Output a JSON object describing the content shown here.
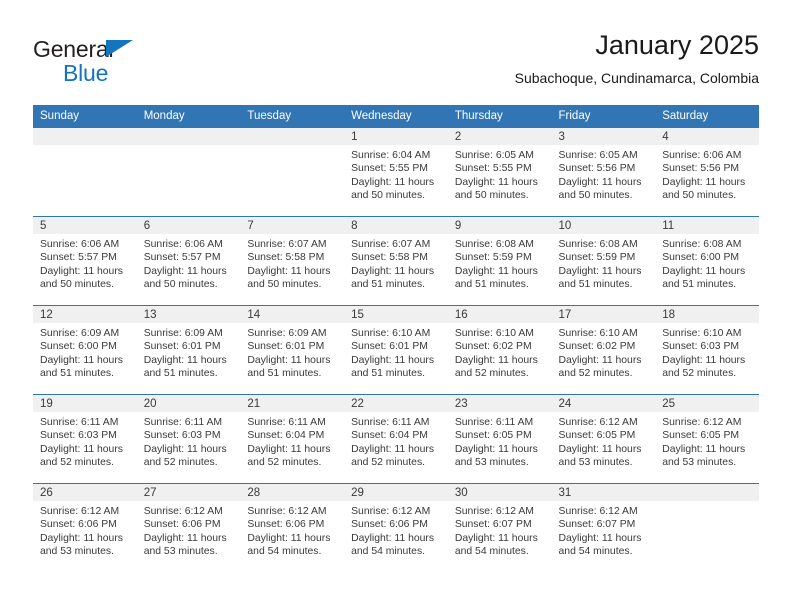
{
  "brand": {
    "name_part1": "General",
    "name_part2": "Blue",
    "triangle_icon": "brand-triangle-icon",
    "colors": {
      "dark": "#231f20",
      "blue": "#1574bf"
    }
  },
  "header": {
    "title": "January 2025",
    "subtitle": "Subachoque, Cundinamarca, Colombia"
  },
  "theme": {
    "header_blue": "#3175b5",
    "daynum_band": "#f0f0f0",
    "text": "#3a3a3a"
  },
  "calendar": {
    "weekday_headers": [
      "Sunday",
      "Monday",
      "Tuesday",
      "Wednesday",
      "Thursday",
      "Friday",
      "Saturday"
    ],
    "labels": {
      "sunrise": "Sunrise:",
      "sunset": "Sunset:",
      "daylight": "Daylight:"
    },
    "weeks": [
      [
        {
          "day": "",
          "empty": true
        },
        {
          "day": "",
          "empty": true
        },
        {
          "day": "",
          "empty": true
        },
        {
          "day": "1",
          "sunrise": "Sunrise: 6:04 AM",
          "sunset": "Sunset: 5:55 PM",
          "daylight_l1": "Daylight: 11 hours",
          "daylight_l2": "and 50 minutes."
        },
        {
          "day": "2",
          "sunrise": "Sunrise: 6:05 AM",
          "sunset": "Sunset: 5:55 PM",
          "daylight_l1": "Daylight: 11 hours",
          "daylight_l2": "and 50 minutes."
        },
        {
          "day": "3",
          "sunrise": "Sunrise: 6:05 AM",
          "sunset": "Sunset: 5:56 PM",
          "daylight_l1": "Daylight: 11 hours",
          "daylight_l2": "and 50 minutes."
        },
        {
          "day": "4",
          "sunrise": "Sunrise: 6:06 AM",
          "sunset": "Sunset: 5:56 PM",
          "daylight_l1": "Daylight: 11 hours",
          "daylight_l2": "and 50 minutes."
        }
      ],
      [
        {
          "day": "5",
          "sunrise": "Sunrise: 6:06 AM",
          "sunset": "Sunset: 5:57 PM",
          "daylight_l1": "Daylight: 11 hours",
          "daylight_l2": "and 50 minutes."
        },
        {
          "day": "6",
          "sunrise": "Sunrise: 6:06 AM",
          "sunset": "Sunset: 5:57 PM",
          "daylight_l1": "Daylight: 11 hours",
          "daylight_l2": "and 50 minutes."
        },
        {
          "day": "7",
          "sunrise": "Sunrise: 6:07 AM",
          "sunset": "Sunset: 5:58 PM",
          "daylight_l1": "Daylight: 11 hours",
          "daylight_l2": "and 50 minutes."
        },
        {
          "day": "8",
          "sunrise": "Sunrise: 6:07 AM",
          "sunset": "Sunset: 5:58 PM",
          "daylight_l1": "Daylight: 11 hours",
          "daylight_l2": "and 51 minutes."
        },
        {
          "day": "9",
          "sunrise": "Sunrise: 6:08 AM",
          "sunset": "Sunset: 5:59 PM",
          "daylight_l1": "Daylight: 11 hours",
          "daylight_l2": "and 51 minutes."
        },
        {
          "day": "10",
          "sunrise": "Sunrise: 6:08 AM",
          "sunset": "Sunset: 5:59 PM",
          "daylight_l1": "Daylight: 11 hours",
          "daylight_l2": "and 51 minutes."
        },
        {
          "day": "11",
          "sunrise": "Sunrise: 6:08 AM",
          "sunset": "Sunset: 6:00 PM",
          "daylight_l1": "Daylight: 11 hours",
          "daylight_l2": "and 51 minutes."
        }
      ],
      [
        {
          "day": "12",
          "sunrise": "Sunrise: 6:09 AM",
          "sunset": "Sunset: 6:00 PM",
          "daylight_l1": "Daylight: 11 hours",
          "daylight_l2": "and 51 minutes."
        },
        {
          "day": "13",
          "sunrise": "Sunrise: 6:09 AM",
          "sunset": "Sunset: 6:01 PM",
          "daylight_l1": "Daylight: 11 hours",
          "daylight_l2": "and 51 minutes."
        },
        {
          "day": "14",
          "sunrise": "Sunrise: 6:09 AM",
          "sunset": "Sunset: 6:01 PM",
          "daylight_l1": "Daylight: 11 hours",
          "daylight_l2": "and 51 minutes."
        },
        {
          "day": "15",
          "sunrise": "Sunrise: 6:10 AM",
          "sunset": "Sunset: 6:01 PM",
          "daylight_l1": "Daylight: 11 hours",
          "daylight_l2": "and 51 minutes."
        },
        {
          "day": "16",
          "sunrise": "Sunrise: 6:10 AM",
          "sunset": "Sunset: 6:02 PM",
          "daylight_l1": "Daylight: 11 hours",
          "daylight_l2": "and 52 minutes."
        },
        {
          "day": "17",
          "sunrise": "Sunrise: 6:10 AM",
          "sunset": "Sunset: 6:02 PM",
          "daylight_l1": "Daylight: 11 hours",
          "daylight_l2": "and 52 minutes."
        },
        {
          "day": "18",
          "sunrise": "Sunrise: 6:10 AM",
          "sunset": "Sunset: 6:03 PM",
          "daylight_l1": "Daylight: 11 hours",
          "daylight_l2": "and 52 minutes."
        }
      ],
      [
        {
          "day": "19",
          "sunrise": "Sunrise: 6:11 AM",
          "sunset": "Sunset: 6:03 PM",
          "daylight_l1": "Daylight: 11 hours",
          "daylight_l2": "and 52 minutes."
        },
        {
          "day": "20",
          "sunrise": "Sunrise: 6:11 AM",
          "sunset": "Sunset: 6:03 PM",
          "daylight_l1": "Daylight: 11 hours",
          "daylight_l2": "and 52 minutes."
        },
        {
          "day": "21",
          "sunrise": "Sunrise: 6:11 AM",
          "sunset": "Sunset: 6:04 PM",
          "daylight_l1": "Daylight: 11 hours",
          "daylight_l2": "and 52 minutes."
        },
        {
          "day": "22",
          "sunrise": "Sunrise: 6:11 AM",
          "sunset": "Sunset: 6:04 PM",
          "daylight_l1": "Daylight: 11 hours",
          "daylight_l2": "and 52 minutes."
        },
        {
          "day": "23",
          "sunrise": "Sunrise: 6:11 AM",
          "sunset": "Sunset: 6:05 PM",
          "daylight_l1": "Daylight: 11 hours",
          "daylight_l2": "and 53 minutes."
        },
        {
          "day": "24",
          "sunrise": "Sunrise: 6:12 AM",
          "sunset": "Sunset: 6:05 PM",
          "daylight_l1": "Daylight: 11 hours",
          "daylight_l2": "and 53 minutes."
        },
        {
          "day": "25",
          "sunrise": "Sunrise: 6:12 AM",
          "sunset": "Sunset: 6:05 PM",
          "daylight_l1": "Daylight: 11 hours",
          "daylight_l2": "and 53 minutes."
        }
      ],
      [
        {
          "day": "26",
          "sunrise": "Sunrise: 6:12 AM",
          "sunset": "Sunset: 6:06 PM",
          "daylight_l1": "Daylight: 11 hours",
          "daylight_l2": "and 53 minutes."
        },
        {
          "day": "27",
          "sunrise": "Sunrise: 6:12 AM",
          "sunset": "Sunset: 6:06 PM",
          "daylight_l1": "Daylight: 11 hours",
          "daylight_l2": "and 53 minutes."
        },
        {
          "day": "28",
          "sunrise": "Sunrise: 6:12 AM",
          "sunset": "Sunset: 6:06 PM",
          "daylight_l1": "Daylight: 11 hours",
          "daylight_l2": "and 54 minutes."
        },
        {
          "day": "29",
          "sunrise": "Sunrise: 6:12 AM",
          "sunset": "Sunset: 6:06 PM",
          "daylight_l1": "Daylight: 11 hours",
          "daylight_l2": "and 54 minutes."
        },
        {
          "day": "30",
          "sunrise": "Sunrise: 6:12 AM",
          "sunset": "Sunset: 6:07 PM",
          "daylight_l1": "Daylight: 11 hours",
          "daylight_l2": "and 54 minutes."
        },
        {
          "day": "31",
          "sunrise": "Sunrise: 6:12 AM",
          "sunset": "Sunset: 6:07 PM",
          "daylight_l1": "Daylight: 11 hours",
          "daylight_l2": "and 54 minutes."
        },
        {
          "day": "",
          "empty": true
        }
      ]
    ]
  }
}
